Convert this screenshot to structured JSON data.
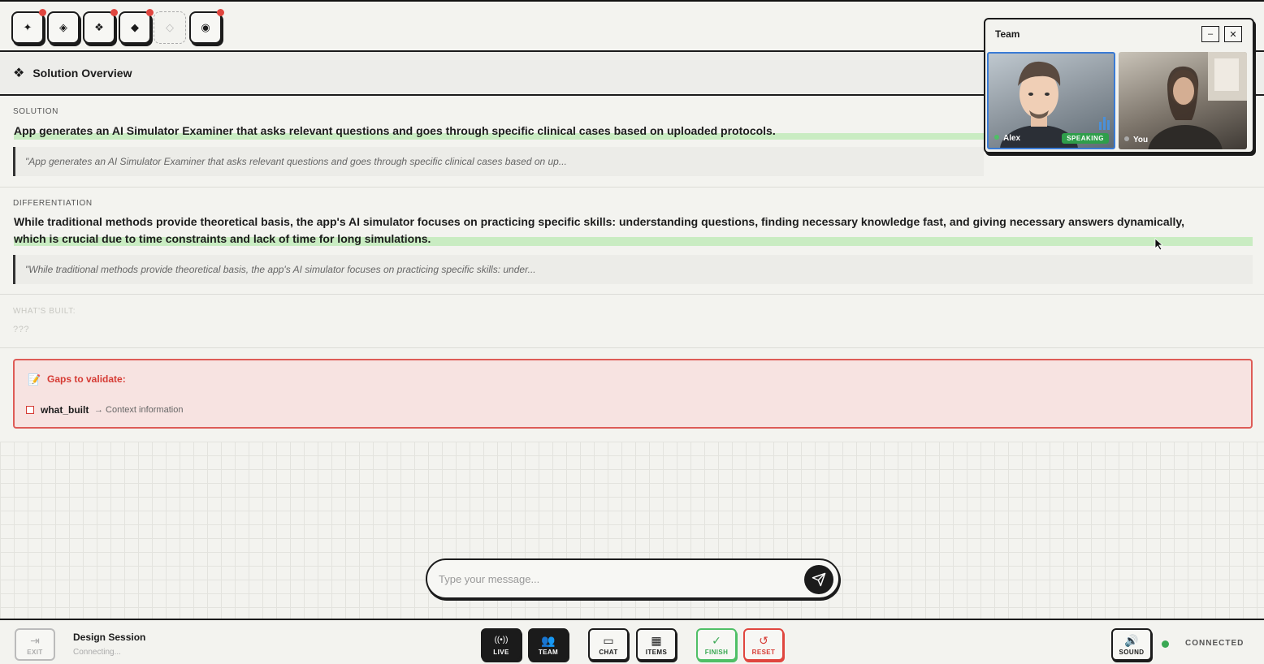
{
  "toolbar": {
    "tools": [
      {
        "icon": "sparkle-icon",
        "glyph": "✦",
        "badge": true
      },
      {
        "icon": "diamond-outline-icon",
        "glyph": "◈",
        "badge": false
      },
      {
        "icon": "cluster-icon",
        "glyph": "❖",
        "badge": true
      },
      {
        "icon": "diamond-icon",
        "glyph": "◆",
        "badge": true
      },
      {
        "icon": "empty-diamond-icon",
        "glyph": "◇",
        "badge": false
      },
      {
        "icon": "target-icon",
        "glyph": "◉",
        "badge": true
      }
    ]
  },
  "header": {
    "icon": "❖",
    "title": "Solution Overview"
  },
  "solution": {
    "label": "SOLUTION",
    "text": "App generates an AI Simulator Examiner that asks relevant questions and goes through specific clinical cases based on uploaded protocols.",
    "quote": "\"App generates an AI Simulator Examiner that asks relevant questions and goes through specific clinical cases based on up..."
  },
  "differentiation": {
    "label": "DIFFERENTIATION",
    "text_line1": "While traditional methods provide theoretical basis, the app's AI simulator focuses on practicing specific skills: understanding questions, finding necessary knowledge fast, and giving necessary answers dynamically,",
    "text_line2": "which is crucial due to time constraints and lack of time for long simulations.",
    "quote": "\"While traditional methods provide theoretical basis, the app's AI simulator focuses on practicing specific skills: under..."
  },
  "whats_built": {
    "label": "WHAT'S BUILT:",
    "value": "???"
  },
  "gaps": {
    "icon": "📝",
    "title": "Gaps to validate:",
    "items": [
      {
        "name": "what_built",
        "desc": "→ Context information"
      }
    ]
  },
  "message": {
    "placeholder": "Type your message...",
    "value": ""
  },
  "team": {
    "title": "Team",
    "minimize": "–",
    "close": "✕",
    "alex": {
      "name": "Alex",
      "status": "SPEAKING"
    },
    "you": {
      "name": "You"
    }
  },
  "bottom": {
    "exit": {
      "icon": "⇥",
      "label": "EXIT"
    },
    "session_title": "Design Session",
    "session_status": "Connecting...",
    "live": {
      "icon": "((•))",
      "label": "LIVE"
    },
    "team_btn": {
      "icon": "👥",
      "label": "TEAM"
    },
    "chat": {
      "icon": "▭",
      "label": "CHAT"
    },
    "items": {
      "icon": "▦",
      "label": "ITEMS"
    },
    "finish": {
      "icon": "✓",
      "label": "FINISH"
    },
    "reset": {
      "icon": "↺",
      "label": "RESET"
    },
    "sound": {
      "icon": "🔊",
      "label": "SOUND"
    },
    "connection": "CONNECTED"
  },
  "colors": {
    "accent_green": "#3aa853",
    "accent_red": "#d63b34",
    "highlight": "#c9ecc2"
  }
}
